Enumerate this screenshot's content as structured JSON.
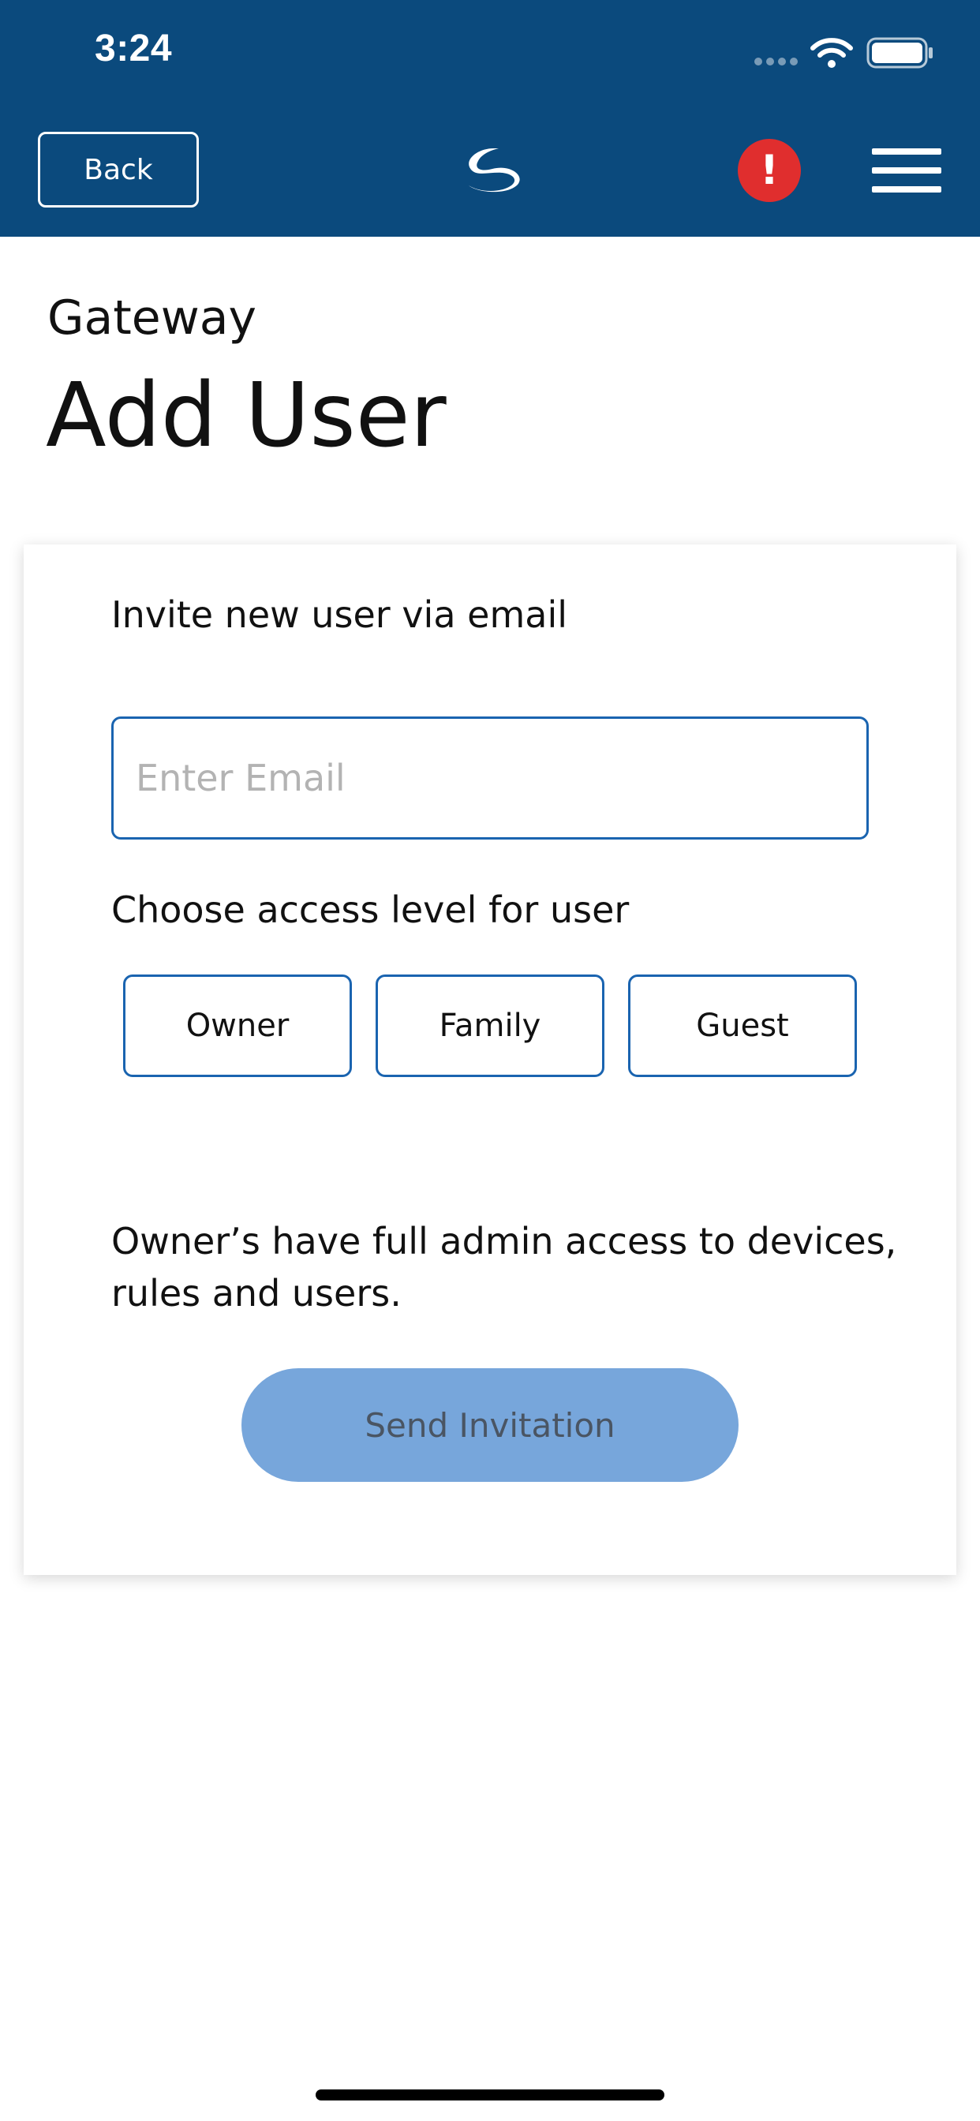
{
  "status_bar": {
    "time": "3:24",
    "icons": [
      "signal-icon",
      "wifi-icon",
      "battery-icon"
    ]
  },
  "nav_bar": {
    "back_label": "Back",
    "logo": "brand-logo-icon",
    "alert_glyph": "!",
    "menu": "hamburger-menu-icon"
  },
  "page": {
    "breadcrumb": "Gateway",
    "title": "Add User"
  },
  "invite_form": {
    "invite_label": "Invite new user via email",
    "email_placeholder": "Enter Email",
    "email_value": "",
    "access_label": "Choose access level for user",
    "access_options": [
      "Owner",
      "Family",
      "Guest"
    ],
    "access_description": "Owner’s have full admin access to devices, rules and users.",
    "send_label": "Send Invitation"
  },
  "colors": {
    "header_background": "#0b4a7d",
    "accent_border": "#1a64b0",
    "alert": "#e02e2e",
    "send_button_disabled": "#77a6db"
  }
}
